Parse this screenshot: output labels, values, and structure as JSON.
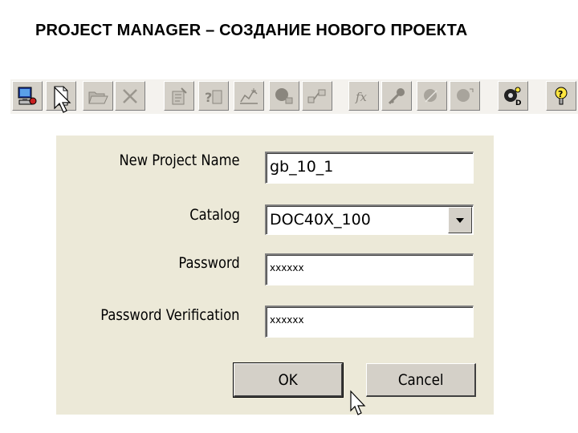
{
  "title": "PROJECT MANAGER – СОЗДАНИЕ НОВОГО ПРОЕКТА",
  "toolbar": {
    "buttons": [
      {
        "icon": "computer-icon",
        "enabled": true
      },
      {
        "icon": "new-document-icon",
        "enabled": true
      },
      {
        "icon": "open-folder-icon",
        "enabled": false
      },
      {
        "icon": "delete-icon",
        "enabled": false
      },
      {
        "icon": "properties-icon",
        "enabled": false
      },
      {
        "icon": "question-properties-icon",
        "enabled": false
      },
      {
        "icon": "chart-icon",
        "enabled": false
      },
      {
        "icon": "network-icon",
        "enabled": false
      },
      {
        "icon": "flow-icon",
        "enabled": false
      },
      {
        "icon": "function-icon",
        "enabled": false
      },
      {
        "icon": "key-icon",
        "enabled": false
      },
      {
        "icon": "run-icon",
        "enabled": false
      },
      {
        "icon": "run-settings-icon",
        "enabled": false
      },
      {
        "icon": "data-icon",
        "enabled": true
      },
      {
        "icon": "help-icon",
        "enabled": true
      }
    ]
  },
  "dialog": {
    "fields": {
      "project_name": {
        "label": "New Project Name",
        "value": "gb_10_1"
      },
      "catalog": {
        "label": "Catalog",
        "value": "DOC40X_100"
      },
      "password": {
        "label": "Password",
        "value": "xxxxxx"
      },
      "password_verification": {
        "label": "Password Verification",
        "value": "xxxxxx"
      }
    },
    "ok_label": "OK",
    "cancel_label": "Cancel"
  },
  "colors": {
    "dialog_bg": "#ece9d8",
    "button_face": "#d4d0c8"
  }
}
